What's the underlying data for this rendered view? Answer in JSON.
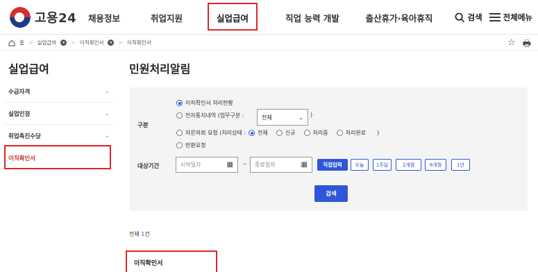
{
  "header": {
    "logo_text": "고용24",
    "nav": [
      "채용정보",
      "취업지원",
      "실업급여",
      "직업 능력 개발",
      "출산휴가·육아휴직"
    ],
    "search_label": "검색",
    "menu_label": "전체메뉴"
  },
  "breadcrumb": [
    "홈",
    "실업급여",
    "이직확인서",
    "이직확인서"
  ],
  "sidebar": {
    "title": "실업급여",
    "items": [
      "수급자격",
      "실업인정",
      "취업촉진수당",
      "이직확인서"
    ]
  },
  "main": {
    "title": "민원처리알림",
    "type_label": "구분",
    "options": {
      "opt1": "이직확인서 처리현황",
      "opt2": "전자통지내역 (업무구분 :",
      "opt2_close": ")",
      "opt3_prefix": "자문의뢰 요청 (처리상태 :",
      "opt3_all": "전체",
      "opt3_new": "신규",
      "opt3_progress": "처리중",
      "opt3_done": "처리완료",
      "opt3_close": ")",
      "opt4": "반환요청"
    },
    "select_value": "전체",
    "period_label": "대상기간",
    "start_placeholder": "시작일자",
    "tilde": "~",
    "end_placeholder": "종료일자",
    "direct_input": "직접입력",
    "quick": [
      "오늘",
      "1주일",
      "1개월",
      "6개월",
      "1년"
    ],
    "search_button": "검색",
    "total_prefix": "전체",
    "total_count": "1",
    "total_suffix": "건",
    "result_title": "이직확인서"
  },
  "colors": {
    "accent": "#2f56d8",
    "highlight": "#e02424"
  }
}
